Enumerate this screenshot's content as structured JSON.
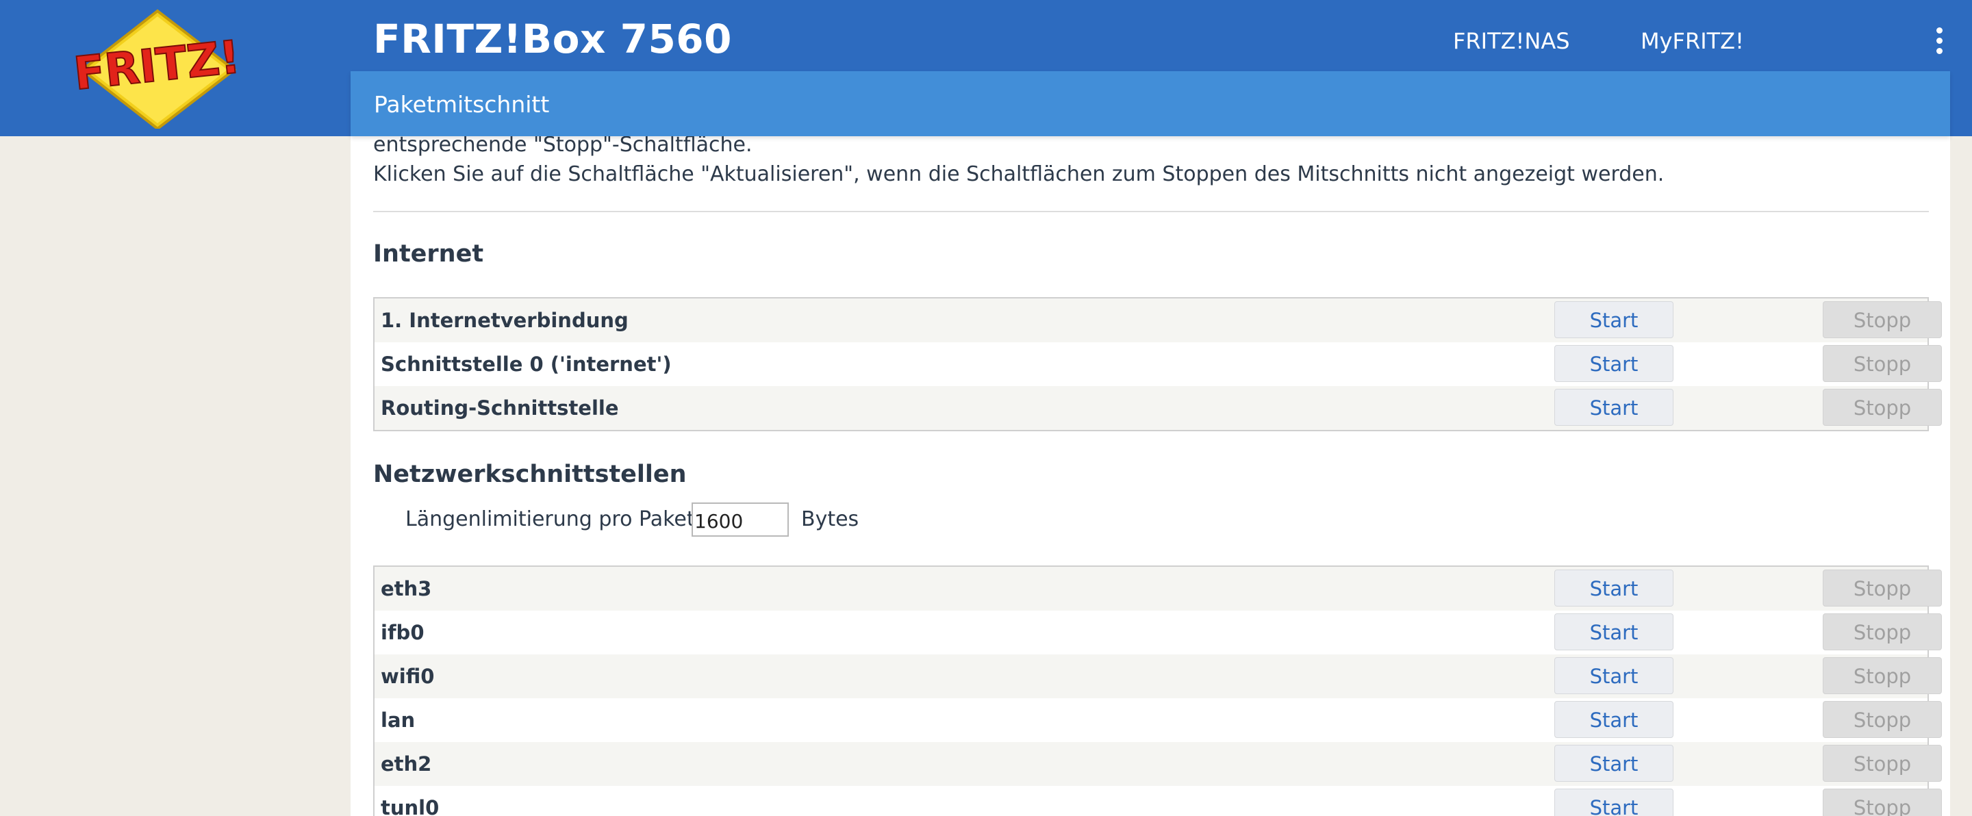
{
  "header": {
    "logo_text": "FRITZ!",
    "product_title": "FRITZ!Box 7560",
    "nav": [
      {
        "label": "FRITZ!NAS"
      },
      {
        "label": "MyFRITZ!"
      }
    ],
    "menu_icon": "kebab-menu-icon"
  },
  "subheader": {
    "title": "Paketmitschnitt"
  },
  "intro": {
    "line1": "entsprechende \"Stopp\"-Schaltfläche.",
    "line2": "Klicken Sie auf die Schaltfläche \"Aktualisieren\", wenn die Schaltflächen zum Stoppen des Mitschnitts nicht angezeigt werden."
  },
  "internet": {
    "heading": "Internet",
    "rows": [
      {
        "label": "1. Internetverbindung",
        "start": "Start",
        "stop": "Stopp"
      },
      {
        "label": "Schnittstelle 0 ('internet')",
        "start": "Start",
        "stop": "Stopp"
      },
      {
        "label": "Routing-Schnittstelle",
        "start": "Start",
        "stop": "Stopp"
      }
    ]
  },
  "network": {
    "heading": "Netzwerkschnittstellen",
    "limit_label": "Längenlimitierung pro Paket",
    "limit_value": "1600",
    "limit_unit": "Bytes",
    "rows": [
      {
        "label": "eth3",
        "start": "Start",
        "stop": "Stopp"
      },
      {
        "label": "ifb0",
        "start": "Start",
        "stop": "Stopp"
      },
      {
        "label": "wifi0",
        "start": "Start",
        "stop": "Stopp"
      },
      {
        "label": "lan",
        "start": "Start",
        "stop": "Stopp"
      },
      {
        "label": "eth2",
        "start": "Start",
        "stop": "Stopp"
      },
      {
        "label": "tunl0",
        "start": "Start",
        "stop": "Stopp"
      }
    ]
  },
  "colors": {
    "header_bg": "#2d6bbf",
    "subheader_bg": "#428ed8",
    "page_bg": "#f0ede6",
    "start_text": "#2d6bbf",
    "stop_disabled_text": "#a0a0a0"
  }
}
